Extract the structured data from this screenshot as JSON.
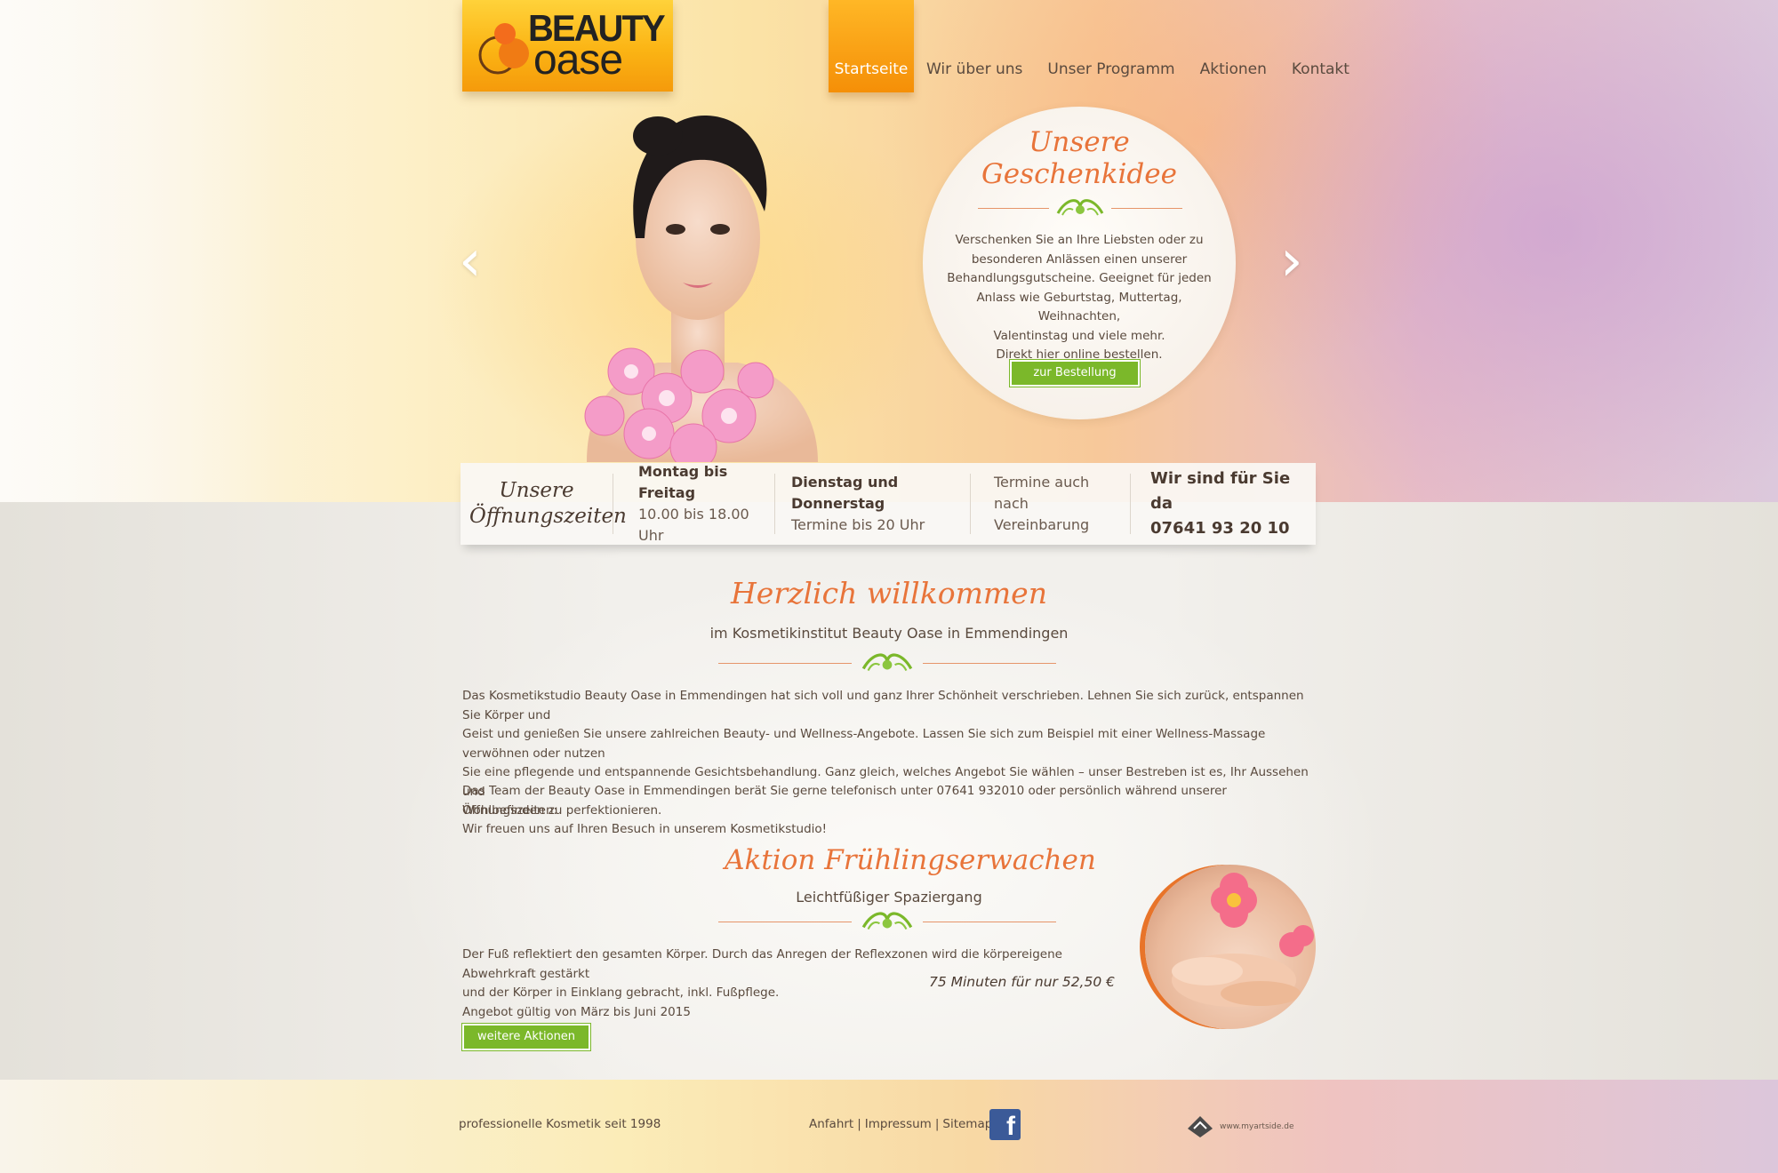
{
  "brand": {
    "word1": "BEAUTY",
    "word2": "oase",
    "colors": {
      "orange": "#f59a0b",
      "accent": "#e8743a",
      "green": "#7bb82a",
      "text": "#5a4a3e"
    }
  },
  "nav": [
    {
      "label": "Startseite",
      "active": true
    },
    {
      "label": "Wir über uns"
    },
    {
      "label": "Unser Programm"
    },
    {
      "label": "Aktionen"
    },
    {
      "label": "Kontakt"
    }
  ],
  "slider": {
    "prev": "‹",
    "next": "›",
    "gift": {
      "title_line1": "Unsere",
      "title_line2": "Geschenkidee",
      "text": [
        "Verschenken Sie an Ihre Liebsten oder zu",
        "besonderen Anlässen einen unserer",
        "Behandlungsgutscheine. Geeignet für jeden",
        "Anlass wie Geburtstag, Muttertag, Weihnachten,",
        "Valentinstag und viele mehr.",
        "Direkt hier online bestellen."
      ],
      "button": "zur Bestellung"
    }
  },
  "hours": {
    "title_line1": "Unsere",
    "title_line2": "Öffnungszeiten",
    "weekdays_label": "Montag bis Freitag",
    "weekdays_time": "10.00 bis 18.00 Uhr",
    "tuethu_label": "Dienstag und Donnerstag",
    "tuethu_time": "Termine bis 20 Uhr",
    "appt_line1": "Termine auch",
    "appt_line2": "nach Vereinbarung",
    "contact_label": "Wir sind für Sie da",
    "contact_phone": "07641 93 20 10"
  },
  "welcome": {
    "title": "Herzlich willkommen",
    "subtitle": "im Kosmetikinstitut Beauty Oase in Emmendingen",
    "para1": [
      "Das Kosmetikstudio Beauty Oase in Emmendingen hat sich voll und ganz Ihrer Schönheit verschrieben. Lehnen Sie sich zurück, entspannen Sie Körper und",
      "Geist und genießen Sie unsere zahlreichen Beauty- und Wellness-Angebote. Lassen Sie sich zum Beispiel mit einer Wellness-Massage verwöhnen oder nutzen",
      "Sie eine pflegende und entspannende Gesichtsbehandlung. Ganz gleich, welches Angebot Sie wählen – unser Bestreben ist es, Ihr Aussehen und",
      "Wohlbefinden zu perfektionieren."
    ],
    "para2": [
      "Das Team der Beauty Oase in Emmendingen berät Sie gerne telefonisch unter 07641 932010 oder persönlich während unserer Öffnungszeiten:",
      "Wir freuen uns auf Ihren Besuch in unserem Kosmetikstudio!"
    ]
  },
  "aktion": {
    "title": "Aktion Frühlingserwachen",
    "subtitle": "Leichtfüßiger Spaziergang",
    "text": [
      "Der Fuß reflektiert den gesamten Körper. Durch das Anregen der Reflexzonen wird die körpereigene Abwehrkraft gestärkt",
      "und der Körper in Einklang gebracht, inkl. Fußpflege.",
      "Angebot gültig von März bis Juni 2015"
    ],
    "price": "75 Minuten für nur 52,50 €",
    "button": "weitere Aktionen"
  },
  "footer": {
    "tagline": "professionelle Kosmetik seit 1998",
    "links": [
      "Anfahrt",
      "|",
      "Impressum",
      "|",
      "Sitemap"
    ],
    "facebook": "f",
    "credit": "www.myartside.de"
  }
}
